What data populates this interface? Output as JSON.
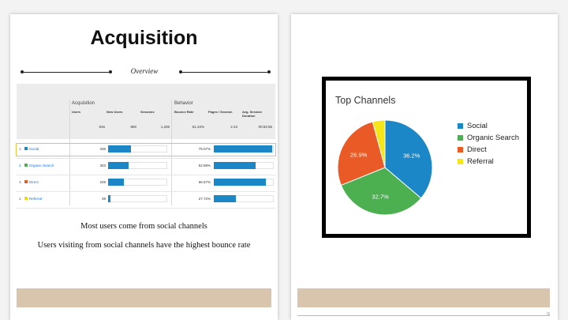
{
  "left_page": {
    "title": "Acquisition",
    "subtitle": "Overview",
    "table": {
      "group_acquisition": "Acquisition",
      "group_behavior": "Behavior",
      "col_users": "Users",
      "col_new_users": "New Users",
      "col_sessions": "Sessions",
      "col_bounce": "Bounce Rate",
      "col_pages": "Pages / Session",
      "col_duration": "Avg. Session Duration",
      "totals": {
        "users": "916",
        "new_users": "890",
        "sessions": "1,206",
        "bounce": "61.34%",
        "pages": "2.43",
        "duration": "00:02:55"
      },
      "rows": [
        {
          "num": "1.",
          "name": "Social",
          "color": "#1b87c6",
          "users": "336",
          "new_users_fraction": 0.38,
          "bounce": "75.07%",
          "bounce_fraction": 0.98
        },
        {
          "num": "2.",
          "name": "Organic Search",
          "color": "#4caf50",
          "users": "303",
          "new_users_fraction": 0.34,
          "bounce": "52.98%",
          "bounce_fraction": 0.7
        },
        {
          "num": "3.",
          "name": "Direct",
          "color": "#ea5a27",
          "users": "249",
          "new_users_fraction": 0.27,
          "bounce": "66.57%",
          "bounce_fraction": 0.87
        },
        {
          "num": "4.",
          "name": "Referral",
          "color": "#f5d80a",
          "users": "39",
          "new_users_fraction": 0.04,
          "bounce": "27.72%",
          "bounce_fraction": 0.37
        }
      ]
    },
    "captions": [
      "Most users come from social channels",
      "Users visiting from social channels have the highest bounce rate"
    ]
  },
  "right_page": {
    "page_number": "9"
  },
  "chart_data": {
    "type": "pie",
    "title": "Top Channels",
    "legend_position": "right",
    "slices": [
      {
        "label": "Social",
        "value": 36.2,
        "display": "36.2%",
        "color": "#1b87c6"
      },
      {
        "label": "Organic Search",
        "value": 32.7,
        "display": "32.7%",
        "color": "#4caf50"
      },
      {
        "label": "Direct",
        "value": 26.9,
        "display": "26.9%",
        "color": "#ea5a27"
      },
      {
        "label": "Referral",
        "value": 4.2,
        "display": "",
        "color": "#f5e61b"
      }
    ]
  }
}
